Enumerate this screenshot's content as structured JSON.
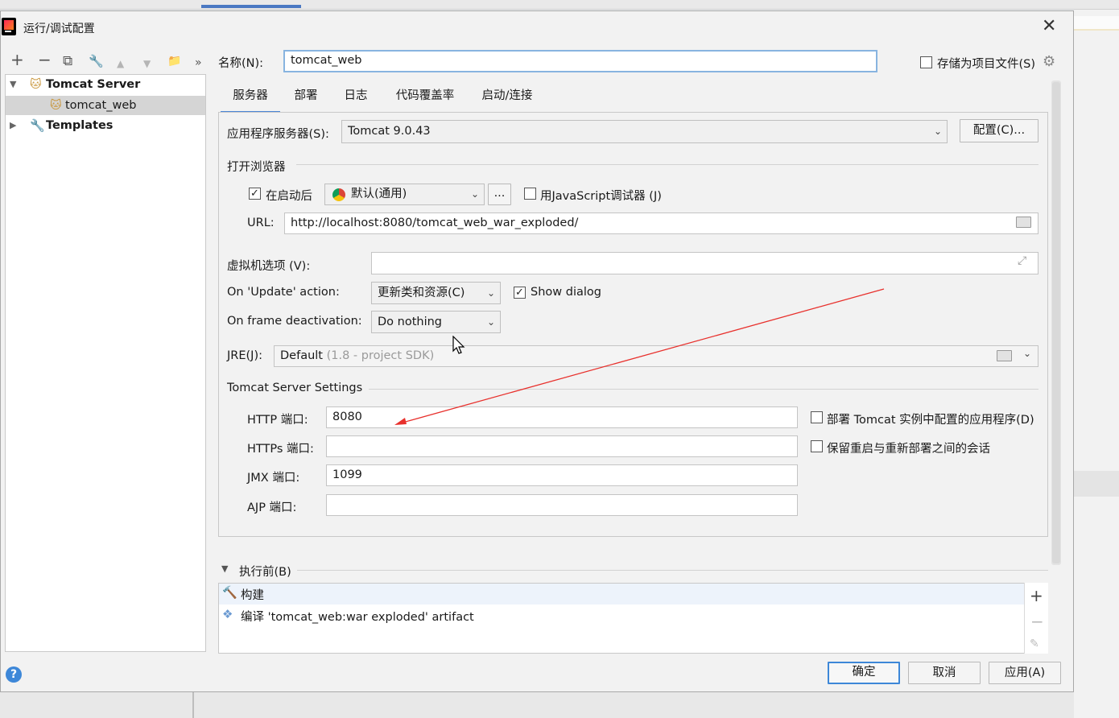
{
  "dialog": {
    "title": "运行/调试配置",
    "close_glyph": "✕"
  },
  "toolbar": {
    "add": "+",
    "remove": "−",
    "copy": "⧉",
    "edit": "🔧",
    "up": "▲",
    "down": "▼",
    "folder": "📁",
    "more": "»"
  },
  "tree": {
    "items": [
      {
        "label": "Tomcat Server",
        "expanded": true,
        "bold": true
      },
      {
        "label": "tomcat_web",
        "selected": true
      },
      {
        "label": "Templates",
        "expanded": false,
        "bold": true
      }
    ]
  },
  "name": {
    "label": "名称(N):",
    "value": "tomcat_web",
    "store_label": "存储为项目文件(S)",
    "store_checked": false
  },
  "tabs": [
    {
      "label": "服务器",
      "active": true
    },
    {
      "label": "部署"
    },
    {
      "label": "日志"
    },
    {
      "label": "代码覆盖率"
    },
    {
      "label": "启动/连接"
    }
  ],
  "server": {
    "app_server_label": "应用程序服务器(S):",
    "app_server_value": "Tomcat 9.0.43",
    "configure_button": "配置(C)..."
  },
  "browser": {
    "section_title": "打开浏览器",
    "after_launch_label": "在启动后",
    "after_launch_checked": true,
    "browser_value": "默认(通用)",
    "dots_button": "...",
    "js_debugger_label": "用JavaScript调试器 (J)",
    "js_debugger_checked": false,
    "url_label": "URL:",
    "url_value": "http://localhost:8080/tomcat_web_war_exploded/"
  },
  "vm": {
    "label": "虚拟机选项 (V):",
    "value": ""
  },
  "update_action": {
    "label": "On 'Update' action:",
    "value": "更新类和资源(C)",
    "show_dialog_label": "Show dialog",
    "show_dialog_checked": true
  },
  "frame_deactivation": {
    "label": "On frame deactivation:",
    "value": "Do nothing"
  },
  "jre": {
    "label": "JRE(J):",
    "value": "Default",
    "hint": "(1.8 - project SDK)"
  },
  "tomcat_settings": {
    "section_title": "Tomcat Server Settings",
    "http_label": "HTTP 端口:",
    "http_value": "8080",
    "https_label": "HTTPs 端口:",
    "https_value": "",
    "jmx_label": "JMX 端口:",
    "jmx_value": "1099",
    "ajp_label": "AJP 端口:",
    "ajp_value": "",
    "deploy_apps_label": "部署 Tomcat 实例中配置的应用程序(D)",
    "deploy_apps_checked": false,
    "preserve_sessions_label": "保留重启与重新部署之间的会话",
    "preserve_sessions_checked": false
  },
  "before_launch": {
    "title": "执行前(B)",
    "items": [
      {
        "label": "构建"
      },
      {
        "label": "编译 'tomcat_web:war exploded' artifact"
      }
    ]
  },
  "footer": {
    "help": "?",
    "ok": "确定",
    "cancel": "取消",
    "apply": "应用(A)"
  },
  "colors": {
    "accent": "#3d87d8",
    "arrow": "#e8302c",
    "tomcat": "#c8953a"
  }
}
